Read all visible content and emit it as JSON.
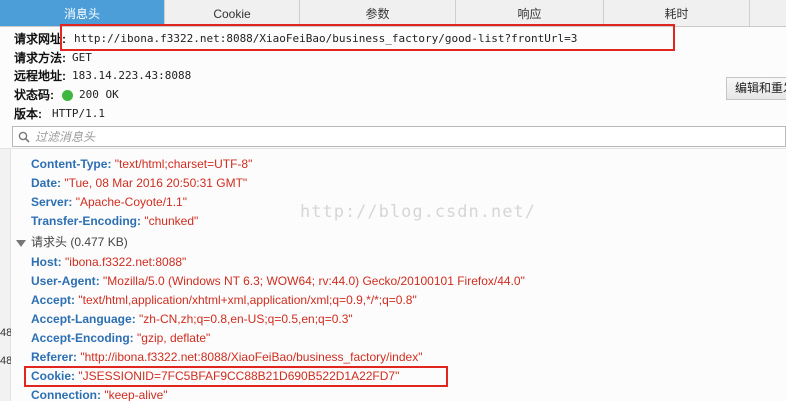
{
  "tabs": [
    {
      "label": "消息头",
      "active": true
    },
    {
      "label": "Cookie",
      "active": false
    },
    {
      "label": "参数",
      "active": false
    },
    {
      "label": "响应",
      "active": false
    },
    {
      "label": "耗时",
      "active": false
    }
  ],
  "summary": {
    "request_url_label": "请求网址:",
    "request_url": "http://ibona.f3322.net:8088/XiaoFeiBao/business_factory/good-list?frontUrl=3",
    "method_label": "请求方法:",
    "method": "GET",
    "remote_label": "远程地址:",
    "remote": "183.14.223.43:8088",
    "status_label": "状态码:",
    "status": "200 OK",
    "version_label": "版本:",
    "version": "HTTP/1.1"
  },
  "edit_resend_label": "编辑和重发",
  "filter": {
    "placeholder": "过滤消息头"
  },
  "response_headers": [
    {
      "name": "Content-Type",
      "value": "\"text/html;charset=UTF-8\""
    },
    {
      "name": "Date",
      "value": "\"Tue, 08 Mar 2016 20:50:31 GMT\""
    },
    {
      "name": "Server",
      "value": "\"Apache-Coyote/1.1\""
    },
    {
      "name": "Transfer-Encoding",
      "value": "\"chunked\""
    }
  ],
  "request_section_label": "请求头 (0.477 KB)",
  "request_headers": [
    {
      "name": "Host",
      "value": "\"ibona.f3322.net:8088\""
    },
    {
      "name": "User-Agent",
      "value": "\"Mozilla/5.0 (Windows NT 6.3; WOW64; rv:44.0) Gecko/20100101 Firefox/44.0\""
    },
    {
      "name": "Accept",
      "value": "\"text/html,application/xhtml+xml,application/xml;q=0.9,*/*;q=0.8\""
    },
    {
      "name": "Accept-Language",
      "value": "\"zh-CN,zh;q=0.8,en-US;q=0.5,en;q=0.3\""
    },
    {
      "name": "Accept-Encoding",
      "value": "\"gzip, deflate\""
    },
    {
      "name": "Referer",
      "value": "\"http://ibona.f3322.net:8088/XiaoFeiBao/business_factory/index\""
    },
    {
      "name": "Cookie",
      "value": "\"JSESSIONID=7FC5BFAF9CC88B21D690B522D1A22FD7\""
    },
    {
      "name": "Connection",
      "value": "\"keep-alive\""
    }
  ],
  "watermark": "http://blog.csdn.net/",
  "left_gutter_numbers": [
    "48",
    "48"
  ],
  "colors": {
    "tab_active": "#4c9ed9",
    "header_name": "#2c6fb3",
    "header_value": "#d02d1f",
    "highlight": "#e0261f",
    "status_ok": "#3fb63f"
  }
}
